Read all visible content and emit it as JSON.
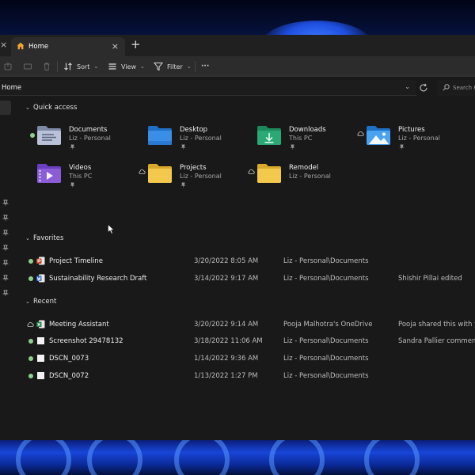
{
  "window": {
    "tab_title": "Home",
    "tab_icon": "home-icon"
  },
  "toolbar": {
    "sort_label": "Sort",
    "view_label": "View",
    "filter_label": "Filter",
    "more_label": "···"
  },
  "address": {
    "path": "Home",
    "search_placeholder": "Search Home"
  },
  "quick_access": {
    "header": "Quick access",
    "items": [
      {
        "name": "Documents",
        "sub": "Liz - Personal",
        "icon": "documents-folder-icon"
      },
      {
        "name": "Desktop",
        "sub": "Liz - Personal",
        "icon": "desktop-folder-icon"
      },
      {
        "name": "Downloads",
        "sub": "This PC",
        "icon": "downloads-folder-icon"
      },
      {
        "name": "Pictures",
        "sub": "Liz - Personal",
        "icon": "pictures-folder-icon"
      },
      {
        "name": "Videos",
        "sub": "This PC",
        "icon": "videos-folder-icon"
      },
      {
        "name": "Projects",
        "sub": "Liz - Personal",
        "icon": "folder-icon"
      },
      {
        "name": "Remodel",
        "sub": "Liz - Personal",
        "icon": "folder-icon"
      }
    ]
  },
  "favorites": {
    "header": "Favorites",
    "rows": [
      {
        "name": "Project Timeline",
        "date": "3/20/2022 8:05 AM",
        "location": "Liz - Personal\\Documents",
        "activity": ""
      },
      {
        "name": "Sustainability Research Draft",
        "date": "3/14/2022 9:17 AM",
        "location": "Liz - Personal\\Documents",
        "activity": "Shishir Pillai edited"
      }
    ]
  },
  "recent": {
    "header": "Recent",
    "rows": [
      {
        "name": "Meeting Assistant",
        "date": "3/20/2022 9:14 AM",
        "location": "Pooja Malhotra's OneDrive",
        "activity": "Pooja shared this with you"
      },
      {
        "name": "Screenshot 29478132",
        "date": "3/18/2022 11:06 AM",
        "location": "Liz - Personal\\Documents",
        "activity": "Sandra Pallier commented"
      },
      {
        "name": "DSCN_0073",
        "date": "1/14/2022 9:36 AM",
        "location": "Liz - Personal\\Documents",
        "activity": ""
      },
      {
        "name": "DSCN_0072",
        "date": "1/13/2022 1:27 PM",
        "location": "Liz - Personal\\Documents",
        "activity": ""
      }
    ]
  },
  "colors": {
    "folder_yellow": "#f2c94c",
    "folder_blue": "#3a8ee6",
    "folder_teal": "#2aa876",
    "folder_purple": "#8a5cd6",
    "window_bg": "#191919",
    "toolbar_bg": "#2c2c2c",
    "synced_green": "#8fd08f"
  }
}
